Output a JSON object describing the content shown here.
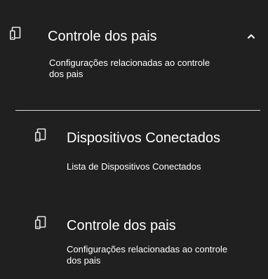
{
  "section": {
    "title": "Controle dos pais",
    "description": "Configurações relacionadas ao controle dos pais",
    "icon": "devices-icon",
    "chevron_icon": "chevron-up-icon",
    "expanded": true
  },
  "items": [
    {
      "title": "Dispositivos Conectados",
      "description": "Lista de Dispositivos Conectados",
      "icon": "devices-icon"
    },
    {
      "title": "Controle dos pais",
      "description": "Configurações relacionadas ao controle dos pais",
      "icon": "devices-icon"
    }
  ],
  "colors": {
    "background": "#202020",
    "text": "#ffffff",
    "divider": "#d8d8d8"
  }
}
